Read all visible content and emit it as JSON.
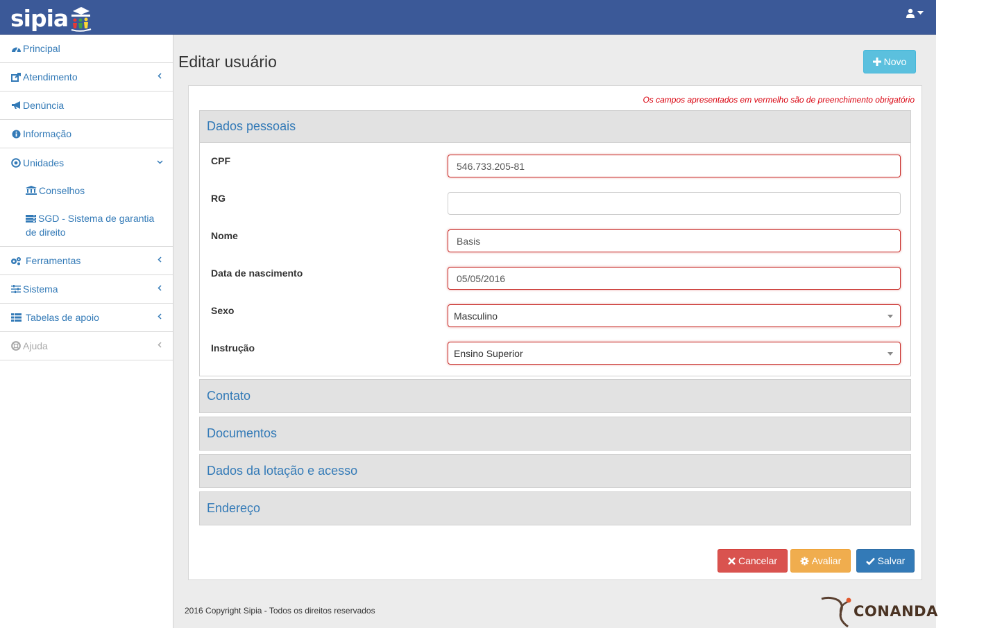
{
  "app": {
    "logo_text": "sipia"
  },
  "sidebar": {
    "items": [
      {
        "label": "Principal",
        "icon": "dashboard-icon"
      },
      {
        "label": "Atendimento",
        "icon": "external-link-icon"
      },
      {
        "label": "Denúncia",
        "icon": "bullhorn-icon"
      },
      {
        "label": "Informação",
        "icon": "info-circle-icon"
      },
      {
        "label": "Unidades",
        "icon": "dot-circle-icon"
      },
      {
        "label": "Ferramentas",
        "icon": "cogs-icon"
      },
      {
        "label": "Sistema",
        "icon": "sliders-icon"
      },
      {
        "label": "Tabelas de apoio",
        "icon": "table-list-icon"
      },
      {
        "label": "Ajuda",
        "icon": "life-ring-icon"
      }
    ],
    "sub_items": [
      {
        "label": "Conselhos",
        "icon": "bank-icon"
      },
      {
        "label": "SGD - Sistema de garantia de direito",
        "icon": "server-icon"
      }
    ]
  },
  "main": {
    "title": "Editar usuário",
    "new_button": "Novo",
    "required_note": "Os campos apresentados em vermelho são de preenchimento obrigatório",
    "sections": {
      "personal": "Dados pessoais",
      "contact": "Contato",
      "documents": "Documentos",
      "access": "Dados da lotação e acesso",
      "address": "Endereço"
    },
    "fields": {
      "cpf_label": "CPF",
      "cpf_value": "546.733.205-81",
      "rg_label": "RG",
      "rg_value": "",
      "name_label": "Nome",
      "name_value": "Basis",
      "birth_label": "Data de nascimento",
      "birth_value": "05/05/2016",
      "sex_label": "Sexo",
      "sex_value": "Masculino",
      "education_label": "Instrução",
      "education_value": "Ensino Superior"
    },
    "actions": {
      "cancel": "Cancelar",
      "evaluate": "Avaliar",
      "save": "Salvar"
    }
  },
  "footer": {
    "copyright": "2016 Copyright Sipia - Todos os direitos reservados",
    "partner_logo": "CONANDA"
  },
  "colors": {
    "topbar": "#3b5998",
    "link": "#337ab7",
    "required": "#d9000d",
    "btn_info": "#5bc0de",
    "btn_danger": "#d9534f",
    "btn_warning": "#f0ad4e",
    "btn_primary": "#337ab7"
  }
}
